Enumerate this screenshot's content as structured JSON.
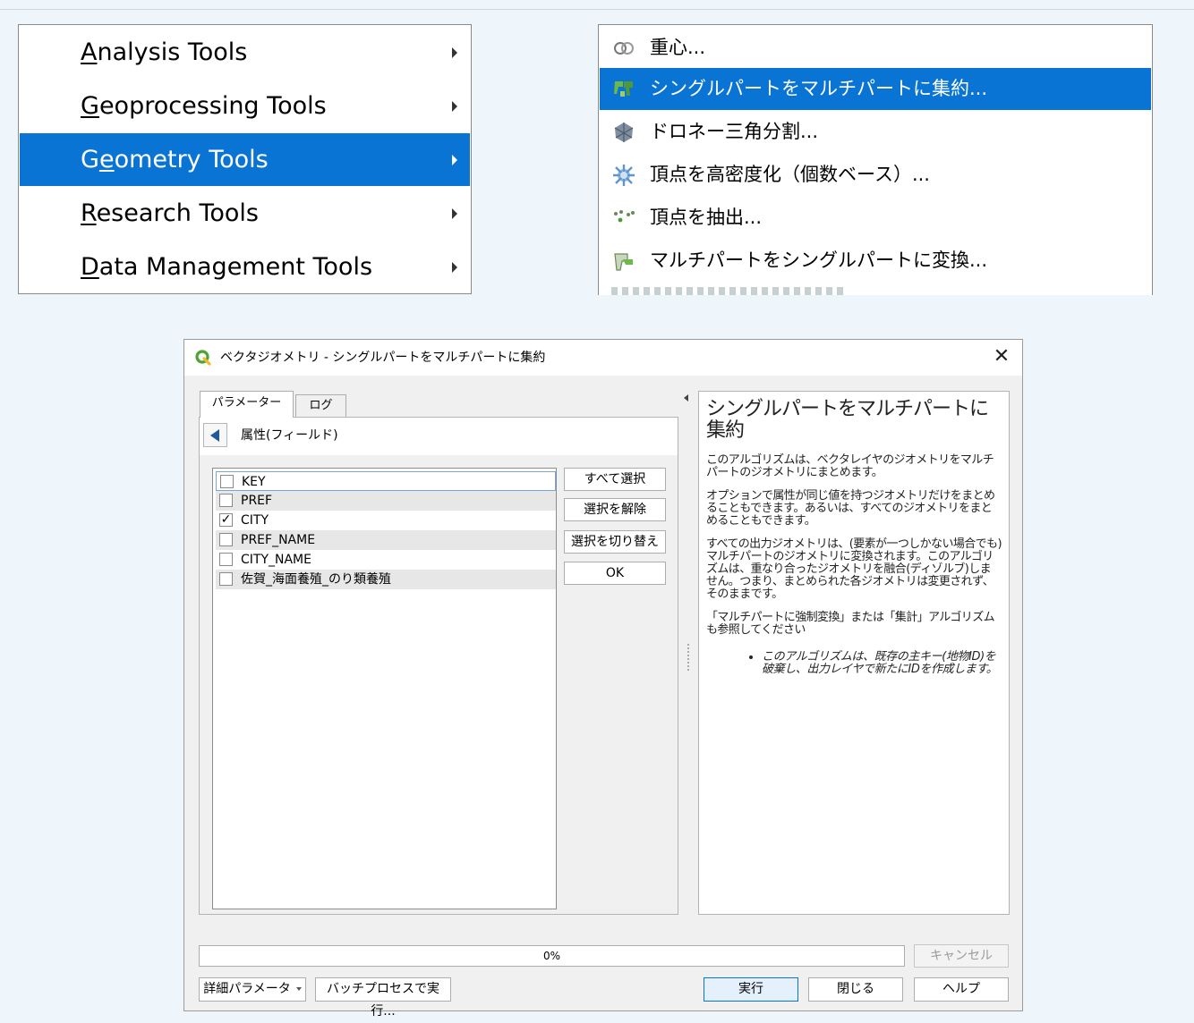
{
  "left_menu": {
    "items": [
      {
        "label": "Analysis Tools",
        "mnemonic": "A",
        "rest": "nalysis Tools"
      },
      {
        "label": "Geoprocessing Tools",
        "mnemonic": "G",
        "rest": "eoprocessing Tools"
      },
      {
        "label": "Geometry Tools",
        "pre": "G",
        "mnemonic": "e",
        "rest": "ometry Tools",
        "selected": true
      },
      {
        "label": "Research Tools",
        "mnemonic": "R",
        "rest": "esearch Tools"
      },
      {
        "label": "Data Management Tools",
        "mnemonic": "D",
        "rest": "ata Management Tools"
      }
    ]
  },
  "right_menu": {
    "items": [
      {
        "label": "重心...",
        "icon": "centroid-icon"
      },
      {
        "label": "シングルパートをマルチパートに集約...",
        "icon": "collect-geometries-icon",
        "selected": true
      },
      {
        "label": "ドロネー三角分割...",
        "icon": "delaunay-icon"
      },
      {
        "label": "頂点を高密度化（個数ベース）...",
        "icon": "densify-icon"
      },
      {
        "label": "頂点を抽出...",
        "icon": "extract-vertices-icon"
      },
      {
        "label": "マルチパートをシングルパートに変換...",
        "icon": "multipart-to-single-icon"
      }
    ]
  },
  "dialog": {
    "title": "ベクタジオメトリ - シングルパートをマルチパートに集約",
    "tabs": {
      "parameters": "パラメーター",
      "log": "ログ"
    },
    "panel_header": "属性(フィールド)",
    "fields": [
      {
        "name": "KEY",
        "checked": false
      },
      {
        "name": "PREF",
        "checked": false
      },
      {
        "name": "CITY",
        "checked": true
      },
      {
        "name": "PREF_NAME",
        "checked": false
      },
      {
        "name": "CITY_NAME",
        "checked": false
      },
      {
        "name": "佐賀_海面養殖_のり類養殖",
        "checked": false
      }
    ],
    "side_buttons": {
      "select_all": "すべて選択",
      "deselect": "選択を解除",
      "toggle": "選択を切り替え",
      "ok": "OK"
    },
    "help": {
      "heading": "シングルパートをマルチパートに集約",
      "p1": "このアルゴリズムは、ベクタレイヤのジオメトリをマルチパートのジオメトリにまとめます。",
      "p2": "オプションで属性が同じ値を持つジオメトリだけをまとめることもできます。あるいは、すべてのジオメトリをまとめることもできます。",
      "p3": "すべての出力ジオメトリは、(要素が一つしかない場合でも)マルチパートのジオメトリに変換されます。このアルゴリズムは、重なり合ったジオメトリを融合(ディゾルブ)しません。つまり、まとめられた各ジオメトリは変更されず、そのままです。",
      "p4": "「マルチパートに強制変換」または「集計」アルゴリズムも参照してください",
      "note": "このアルゴリズムは、既存の主キー(地物ID)を破棄し、出力レイヤで新たにIDを作成します。"
    },
    "progress": {
      "value": 0,
      "label": "0%"
    },
    "buttons": {
      "cancel": "キャンセル",
      "advanced": "詳細パラメータ",
      "batch": "バッチプロセスで実行...",
      "run": "実行",
      "close": "閉じる",
      "help": "ヘルプ"
    }
  },
  "colors": {
    "accent": "#0a74d4",
    "qgis_green": "#4aa532"
  }
}
